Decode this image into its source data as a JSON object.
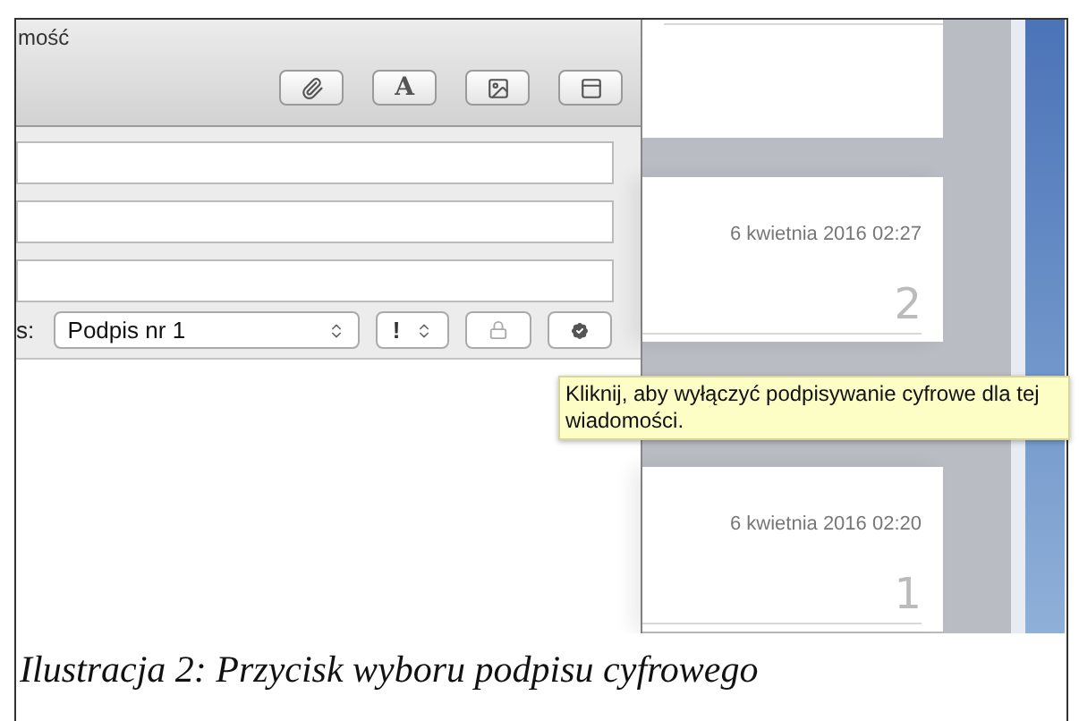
{
  "compose_window": {
    "title": "mość",
    "format_button": "A",
    "signature_label": "s:",
    "signature_select": {
      "value": "Podpis nr 1"
    },
    "priority_select": {
      "value": "!"
    }
  },
  "tooltip": "Kliknij, aby wyłączyć podpisywanie cyfrowe dla tej wiadomości.",
  "messages": [
    {
      "date": "6 kwietnia 2016 02:27",
      "number": "2"
    },
    {
      "date": "6 kwietnia 2016 02:20",
      "number": "1"
    }
  ],
  "caption": "Ilustracja 2: Przycisk wyboru podpisu cyfrowego"
}
